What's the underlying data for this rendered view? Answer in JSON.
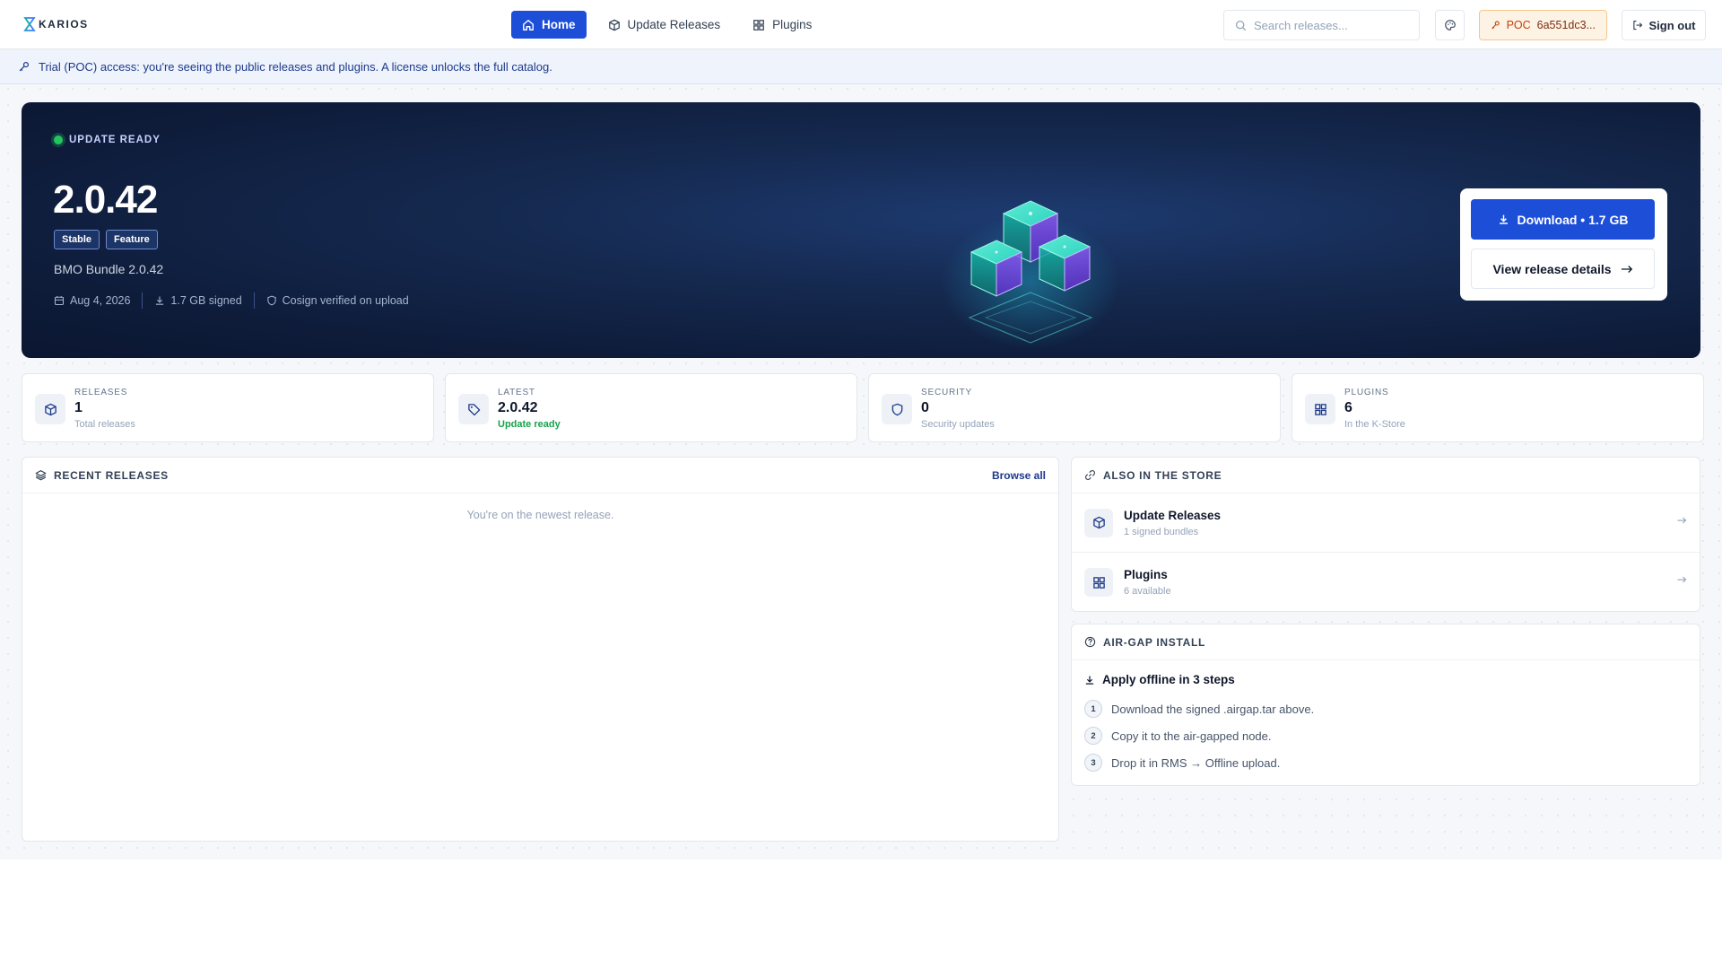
{
  "app": {
    "logo_text": "KARIOS"
  },
  "nav": {
    "items": [
      {
        "label": "Home",
        "icon": "home-icon",
        "active": true
      },
      {
        "label": "Update Releases",
        "icon": "cube-icon",
        "active": false
      },
      {
        "label": "Plugins",
        "icon": "grid-icon",
        "active": false
      }
    ]
  },
  "search": {
    "placeholder": "Search releases...",
    "value": ""
  },
  "poc": {
    "label": "POC",
    "id": "6a551dc3..."
  },
  "signout": {
    "label": "Sign out"
  },
  "banner": {
    "text": "Trial (POC) access: you're seeing the public releases and plugins. A license unlocks the full catalog."
  },
  "hero": {
    "status": "UPDATE READY",
    "version": "2.0.42",
    "tags": [
      "Stable",
      "Feature"
    ],
    "bundle": "BMO Bundle 2.0.42",
    "date": "Aug 4, 2026",
    "size": "1.7 GB signed",
    "verification": "Cosign verified on upload",
    "download_label": "Download • 1.7 GB",
    "details_label": "View release details"
  },
  "stats": [
    {
      "label": "RELEASES",
      "value": "1",
      "sub": "Total releases",
      "icon": "cube-icon"
    },
    {
      "label": "LATEST",
      "value": "2.0.42",
      "sub": "Update ready",
      "icon": "tag-icon"
    },
    {
      "label": "SECURITY",
      "value": "0",
      "sub": "Security updates",
      "icon": "shield-icon"
    },
    {
      "label": "PLUGINS",
      "value": "6",
      "sub": "In the K-Store",
      "icon": "grid-icon"
    }
  ],
  "recent": {
    "title": "RECENT RELEASES",
    "browse_all": "Browse all",
    "empty": "You're on the newest release."
  },
  "store": {
    "title": "ALSO IN THE STORE",
    "items": [
      {
        "title": "Update Releases",
        "sub": "1 signed bundles",
        "icon": "cube-icon"
      },
      {
        "title": "Plugins",
        "sub": "6 available",
        "icon": "grid-icon"
      }
    ]
  },
  "airgap": {
    "title": "AIR-GAP INSTALL",
    "subtitle": "Apply offline in 3 steps",
    "steps": [
      {
        "num": "1",
        "text": "Download the signed .airgap.tar above."
      },
      {
        "num": "2",
        "text": "Copy it to the air-gapped node."
      },
      {
        "num": "3",
        "text": "Drop it in RMS → Offline upload."
      }
    ]
  },
  "colors": {
    "accent": "#1d4ed8",
    "hero_bg": "#0e1c3a",
    "success": "#22c55e",
    "poc_bg": "#fdf3e4"
  }
}
